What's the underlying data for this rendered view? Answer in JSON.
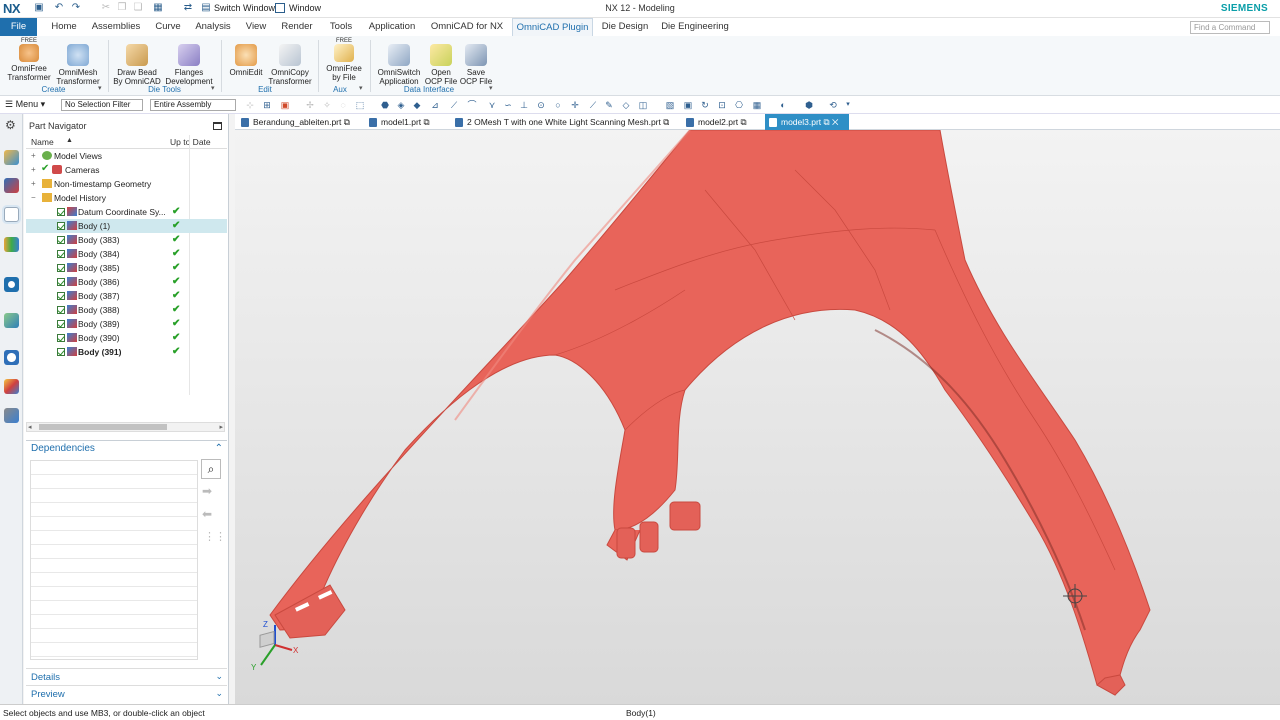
{
  "window": {
    "app_logo": "NX",
    "title": "NX 12 - Modeling",
    "brand": "SIEMENS",
    "switch_window": "Switch Window",
    "window_menu": "Window"
  },
  "menubar": {
    "file": "File",
    "items": [
      "Home",
      "Assemblies",
      "Curve",
      "Analysis",
      "View",
      "Render",
      "Tools",
      "Application",
      "OmniCAD for NX",
      "OmniCAD Plugin",
      "Die Design",
      "Die Engineering"
    ],
    "active": "OmniCAD Plugin",
    "search_placeholder": "Find a Command"
  },
  "ribbon": {
    "buttons": [
      {
        "line1": "OmniFree",
        "line2": "Transformer",
        "badge": "FREE"
      },
      {
        "line1": "OmniMesh",
        "line2": "Transformer"
      },
      {
        "line1": "Draw Bead",
        "line2": "By OmniCAD"
      },
      {
        "line1": "Flanges",
        "line2": "Development"
      },
      {
        "line1": "OmniEdit",
        "line2": ""
      },
      {
        "line1": "OmniCopy",
        "line2": "Transformer"
      },
      {
        "line1": "OmniFree",
        "line2": "by File",
        "badge": "FREE"
      },
      {
        "line1": "OmniSwitch",
        "line2": "Application"
      },
      {
        "line1": "Open",
        "line2": "OCP File"
      },
      {
        "line1": "Save",
        "line2": "OCP File"
      }
    ],
    "groups": [
      "Create",
      "Die Tools",
      "Edit",
      "Aux",
      "Data Interface"
    ]
  },
  "toolbar": {
    "menu": "Menu",
    "selection_filter": "No Selection Filter",
    "scope": "Entire Assembly"
  },
  "navigator": {
    "title": "Part Navigator",
    "col_name": "Name",
    "col_uptodate": "Up to Date",
    "tree": [
      {
        "label": "Model Views"
      },
      {
        "label": "Cameras"
      },
      {
        "label": "Non-timestamp Geometry"
      },
      {
        "label": "Model History"
      },
      {
        "label": "Datum Coordinate Sy..."
      },
      {
        "label": "Body (1)"
      },
      {
        "label": "Body (383)"
      },
      {
        "label": "Body (384)"
      },
      {
        "label": "Body (385)"
      },
      {
        "label": "Body (386)"
      },
      {
        "label": "Body (387)"
      },
      {
        "label": "Body (388)"
      },
      {
        "label": "Body (389)"
      },
      {
        "label": "Body (390)"
      },
      {
        "label": "Body (391)"
      }
    ],
    "dependencies": "Dependencies",
    "details": "Details",
    "preview": "Preview"
  },
  "tabs": [
    "Berandung_ableiten.prt",
    "model1.prt",
    "2 OMesh T with one White Light Scanning Mesh.prt",
    "model2.prt",
    "model3.prt"
  ],
  "status": {
    "prompt": "Select objects and use MB3, or double-click an object",
    "selection": "Body(1)"
  },
  "colors": {
    "accent": "#1f6fad",
    "model": "#e8645a",
    "active_tab": "#2f8fc6"
  }
}
